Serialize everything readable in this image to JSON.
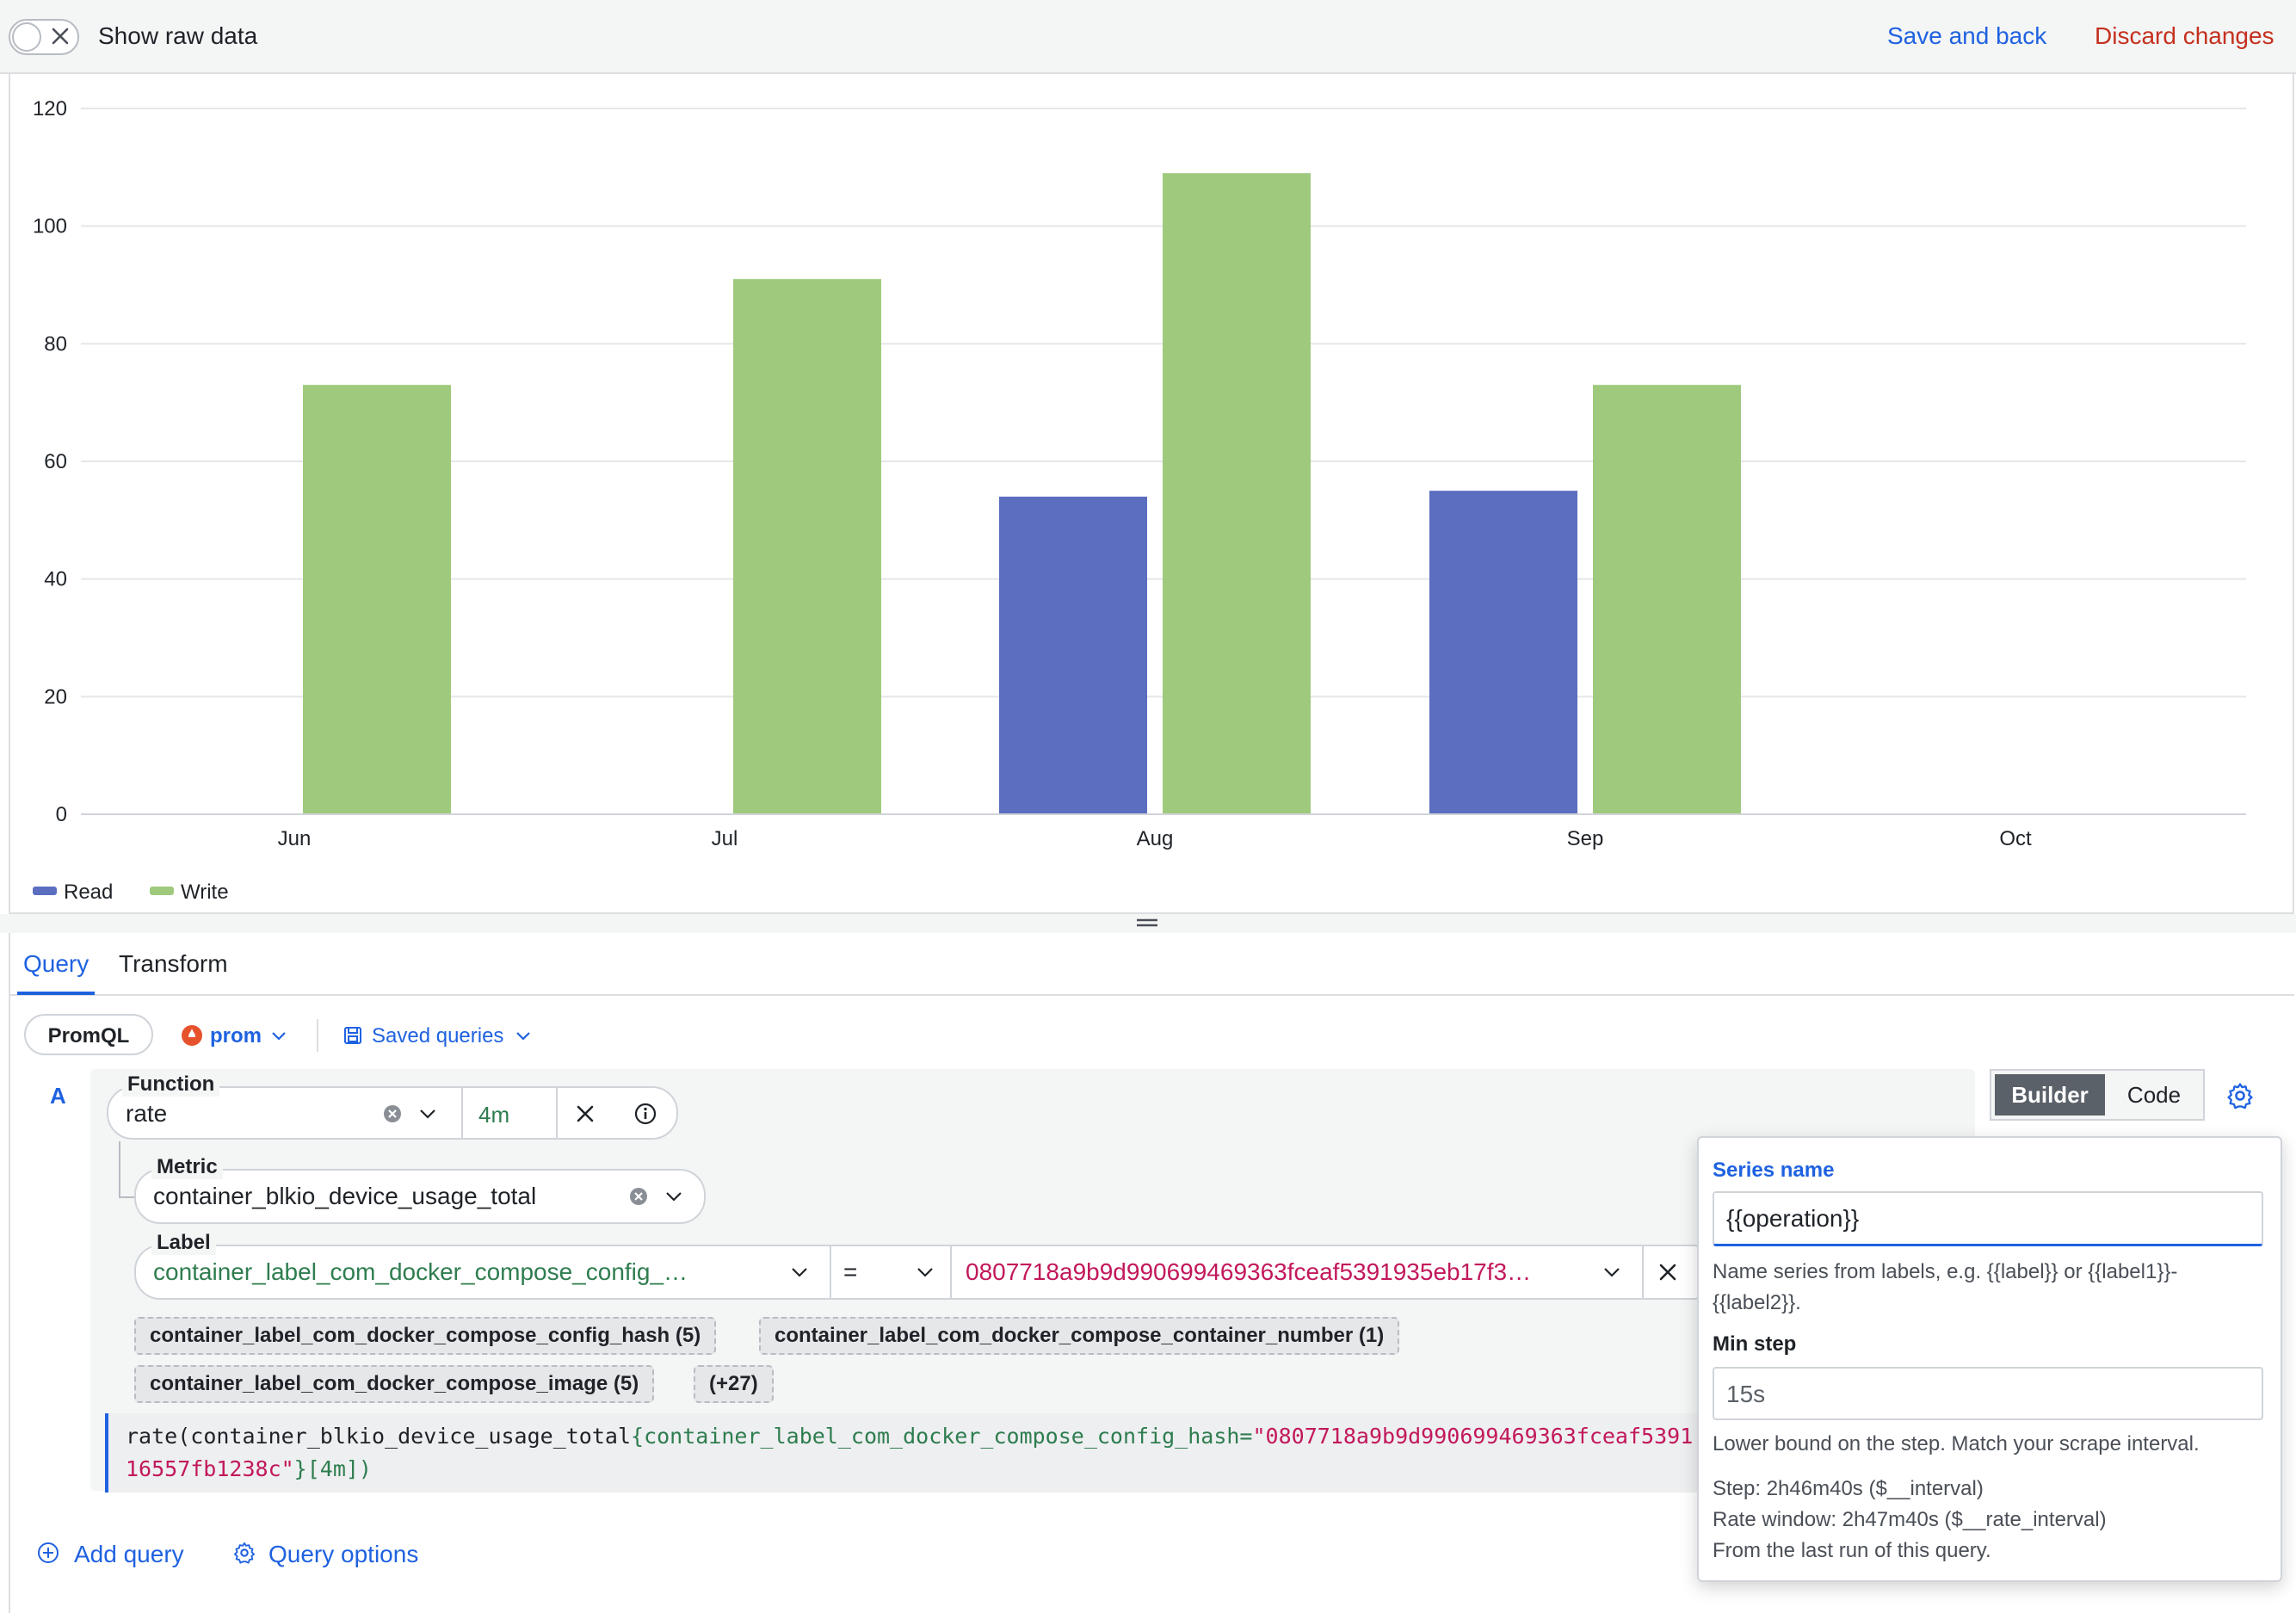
{
  "toolbar": {
    "raw_data_label": "Show raw data",
    "save_label": "Save and back",
    "discard_label": "Discard changes",
    "save_color": "#1f62e0",
    "discard_color": "#c4311f"
  },
  "chart_data": {
    "type": "bar",
    "categories": [
      "Jun",
      "Jul",
      "Aug",
      "Sep",
      "Oct"
    ],
    "series": [
      {
        "name": "Read",
        "color": "#5b6ebf",
        "values": [
          null,
          null,
          54,
          55,
          null
        ]
      },
      {
        "name": "Write",
        "color": "#9fca7d",
        "values": [
          73,
          91,
          109,
          73,
          null
        ]
      }
    ],
    "ylim": [
      0,
      120
    ],
    "yticks": [
      0,
      20,
      40,
      60,
      80,
      100,
      120
    ],
    "grid": true,
    "legend_position": "bottom-left"
  },
  "tabs": {
    "query": "Query",
    "transform": "Transform"
  },
  "query_toolbar": {
    "promql_label": "PromQL",
    "datasource_label": "prom",
    "saved_queries_label": "Saved queries"
  },
  "query_row": {
    "ref_id": "A",
    "function": {
      "title": "Function",
      "value": "rate",
      "range": "4m"
    },
    "metric": {
      "title": "Metric",
      "value": "container_blkio_device_usage_total"
    },
    "label": {
      "title": "Label",
      "name": "container_label_com_docker_compose_config_…",
      "operator": "=",
      "value": "0807718a9b9d990699469363fceaf5391935eb17f3…"
    },
    "label_chips": [
      "container_label_com_docker_compose_config_hash (5)",
      "container_label_com_docker_compose_container_number (1)",
      "container_label_com_docker_compose_image (5)",
      "(+27)"
    ],
    "preview": {
      "fn": "rate(",
      "metric": "container_blkio_device_usage_total",
      "open_brace": "{",
      "label_key": "container_label_com_docker_compose_config_hash=",
      "label_value_line1": "\"0807718a9b9d990699469363fceaf5391",
      "label_value_line2": "16557fb1238c\"",
      "close": "}[4m])"
    }
  },
  "mode_toggle": {
    "builder": "Builder",
    "code": "Code"
  },
  "footer": {
    "add_query": "Add query",
    "query_options": "Query options"
  },
  "settings_popover": {
    "series_name_title": "Series name",
    "series_name_value": "{{operation}}",
    "series_name_help": "Name series from labels, e.g. {{label}} or {{label1}}-{{label2}}.",
    "min_step_title": "Min step",
    "min_step_placeholder": "15s",
    "min_step_help": "Lower bound on the step. Match your scrape interval.",
    "step_line": "Step: 2h46m40s ($__interval)",
    "rate_window_line": "Rate window: 2h47m40s ($__rate_interval)",
    "last_run_line": "From the last run of this query."
  }
}
